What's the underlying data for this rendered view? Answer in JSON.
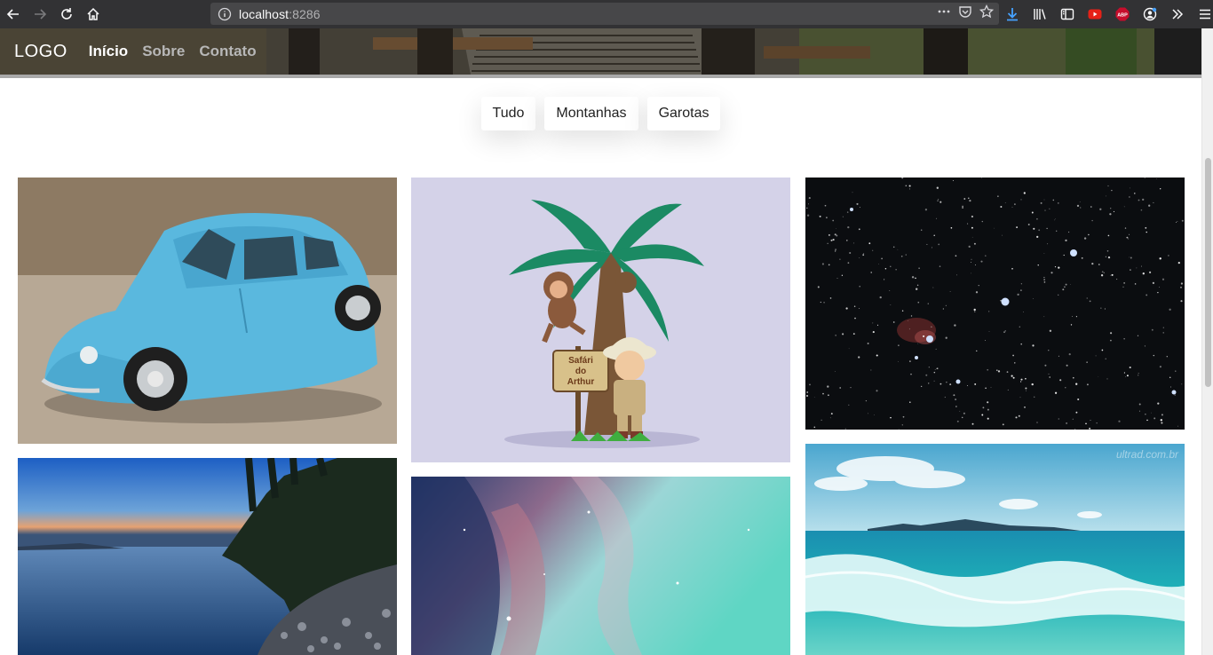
{
  "browser": {
    "url_host": "localhost",
    "url_port": ":8286"
  },
  "site": {
    "logo": "LOGO",
    "nav": [
      {
        "label": "Início",
        "active": true
      },
      {
        "label": "Sobre",
        "active": false
      },
      {
        "label": "Contato",
        "active": false
      }
    ],
    "filters": [
      "Tudo",
      "Montanhas",
      "Garotas"
    ],
    "toy_sign": [
      "Safári",
      "do",
      "Arthur"
    ],
    "watermark": "ultrad.com.br"
  },
  "colors": {
    "accent": "#5bc0e8",
    "sky": "#1f6fd0",
    "sea": "#1fb3b8"
  }
}
